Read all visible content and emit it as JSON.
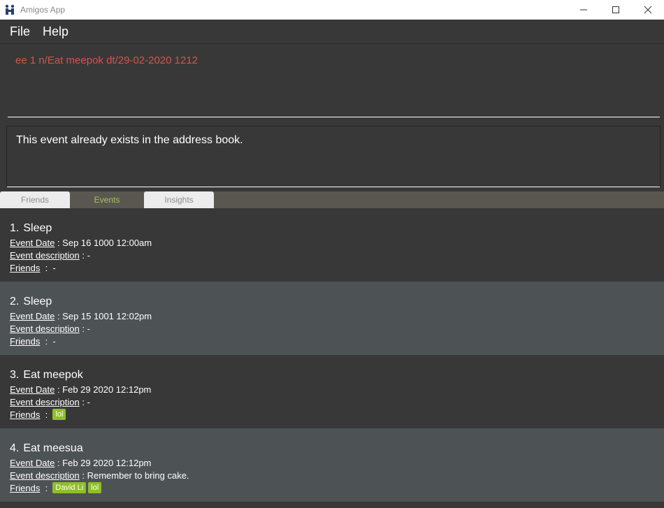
{
  "window": {
    "title": "Amigos App"
  },
  "menu": {
    "items": [
      "File",
      "Help"
    ]
  },
  "command": {
    "value": "ee 1 n/Eat meepok dt/29-02-2020 1212"
  },
  "result": {
    "text": "This event already exists in the address book."
  },
  "tabs": [
    {
      "label": "Friends",
      "active": false
    },
    {
      "label": "Events",
      "active": true
    },
    {
      "label": "Insights",
      "active": false
    }
  ],
  "labels": {
    "date": "Event Date",
    "description": "Event description",
    "friends": "Friends"
  },
  "events": [
    {
      "index": "1.",
      "name": "Sleep",
      "date": "Sep 16 1000 12:00am",
      "description": "-",
      "friends": [],
      "no_friends": "-"
    },
    {
      "index": "2.",
      "name": "Sleep",
      "date": "Sep 15 1001 12:02pm",
      "description": "-",
      "friends": [],
      "no_friends": "-"
    },
    {
      "index": "3.",
      "name": "Eat meepok",
      "date": "Feb 29 2020 12:12pm",
      "description": "-",
      "friends": [
        "lol"
      ],
      "no_friends": ""
    },
    {
      "index": "4.",
      "name": "Eat meesua",
      "date": "Feb 29 2020 12:12pm",
      "description": "Remember to bring cake.",
      "friends": [
        "David Li",
        "lol"
      ],
      "no_friends": ""
    }
  ],
  "colors": {
    "tag": "#8fbf28",
    "error_text": "#d2554a",
    "active_tab": "#a2c25a"
  }
}
